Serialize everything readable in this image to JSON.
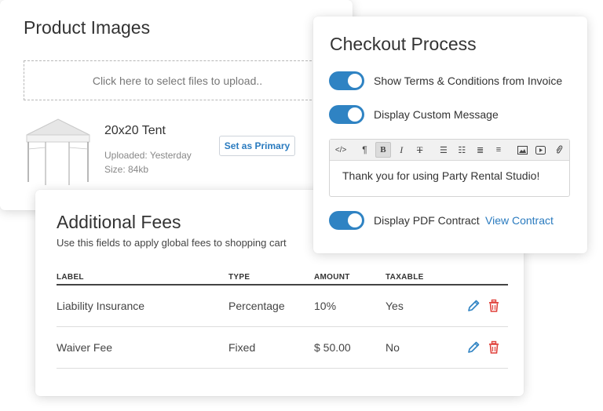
{
  "product_images": {
    "title": "Product Images",
    "upload_placeholder": "Click here to select files to upload..",
    "image": {
      "name": "20x20 Tent",
      "uploaded": "Uploaded: Yesterday",
      "size": "Size: 84kb"
    },
    "set_primary_label": "Set as Primary"
  },
  "additional_fees": {
    "title": "Additional Fees",
    "subtitle": "Use this fields to apply global fees to shopping cart",
    "columns": [
      "LABEL",
      "TYPE",
      "AMOUNT",
      "TAXABLE"
    ],
    "rows": [
      {
        "label": "Liability Insurance",
        "type": "Percentage",
        "amount": "10%",
        "taxable": "Yes"
      },
      {
        "label": "Waiver Fee",
        "type": "Fixed",
        "amount": "$ 50.00",
        "taxable": "No"
      }
    ]
  },
  "checkout": {
    "title": "Checkout Process",
    "toggles": [
      {
        "label": "Show Terms & Conditions from Invoice",
        "on": true
      },
      {
        "label": "Display Custom Message",
        "on": true
      },
      {
        "label": "Display PDF Contract",
        "on": true
      }
    ],
    "editor_text": "Thank you for using Party Rental Studio!",
    "toolbar": [
      "code-icon",
      "paragraph-icon",
      "bold-icon",
      "italic-icon",
      "strikethrough-icon",
      "bullet-list-icon",
      "numbered-list-icon",
      "outdent-icon",
      "indent-icon",
      "image-icon",
      "video-icon",
      "attachment-icon"
    ],
    "view_contract_label": "View Contract"
  },
  "colors": {
    "accent": "#2f83c3",
    "link": "#2a7bbf",
    "delete": "#e0413b"
  }
}
